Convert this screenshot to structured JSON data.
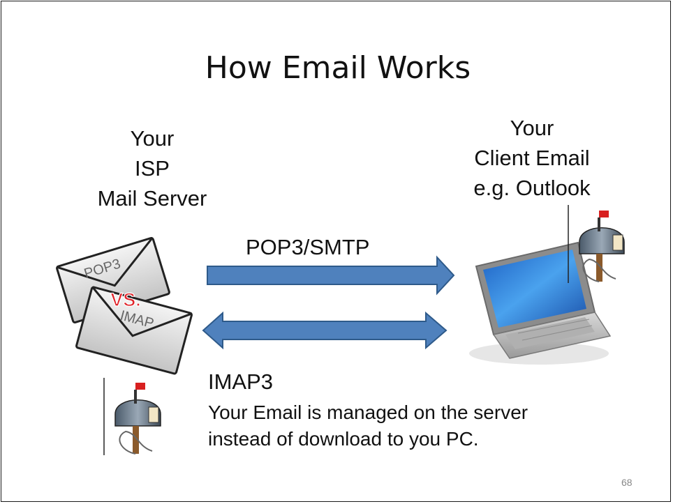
{
  "slide": {
    "title": "How Email Works",
    "server_label": [
      "Your",
      "ISP",
      "Mail Server"
    ],
    "client_label": [
      "Your",
      "Client Email",
      "e.g. Outlook"
    ],
    "protocol_label": "POP3/SMTP",
    "envelope_top": "POP3",
    "vs_text": "VS.",
    "envelope_bottom": "IMAP",
    "imap_title": "IMAP3",
    "imap_description": [
      "Your Email is managed on the server",
      "instead of download to you PC."
    ],
    "page_number": "68"
  },
  "colors": {
    "arrow_fill": "#4f81bd",
    "arrow_stroke": "#2e5a8a",
    "vs_red": "#e0242a",
    "envelope_fill": "#dcdcdc"
  },
  "icons": [
    "envelope-icon",
    "mailbox-icon",
    "laptop-icon"
  ]
}
